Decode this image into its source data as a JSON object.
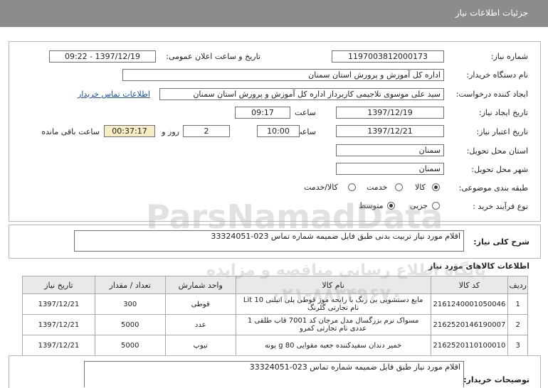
{
  "header": {
    "title": "جزئیات اطلاعات نیاز"
  },
  "form": {
    "need_number_label": "شماره نیاز:",
    "need_number": "1197003812000173",
    "announce_label": "تاریخ و ساعت اعلان عمومی:",
    "announce_value": "1397/12/19 - 09:22",
    "buyer_org_label": "نام دستگاه خریدار:",
    "buyer_org": "اداره کل آموزش و پرورش استان سمنان",
    "requester_label": "ایجاد کننده درخواست:",
    "requester": "سید علی موسوی تلاجیمی کاربرداز اداره کل آموزش و پرورش استان سمنان",
    "contact_link": "اطلاعات تماس خریدار",
    "create_date_label": "تاریخ ایجاد نیاز:",
    "create_date": "1397/12/19",
    "time_label": "ساعت",
    "create_time": "09:17",
    "valid_date_label": "تاریخ اعتبار نیاز:",
    "valid_date": "1397/12/21",
    "valid_time": "10:00",
    "days": "2",
    "days_label": "روز و",
    "remaining": "00:37:17",
    "remaining_label": "ساعت باقی مانده",
    "province_label": "استان محل تحویل:",
    "province": "سمنان",
    "city_label": "شهر محل تحویل:",
    "city": "سمنان",
    "category_label": "طبقه بندی موضوعی:",
    "category_options": [
      "کالا",
      "خدمت",
      "کالا/خدمت"
    ],
    "purchase_label": "نوع فرآیند خرید :",
    "purchase_options": [
      "جزیی",
      "متوسط"
    ]
  },
  "summary": {
    "label": "شرح کلی نیاز:",
    "text": "اقلام مورد نیاز  تربیت بدنی طبق فایل ضمیمه شماره تماس 023-33324051"
  },
  "items_section": {
    "title": "اطلاعات کالاهای مورد نیاز",
    "headers": [
      "ردیف",
      "کد کالا",
      "نام کالا",
      "واحد شمارش",
      "تعداد / مقدار",
      "تاریخ نیاز"
    ],
    "rows": [
      [
        "1",
        "2161240001050046",
        "مایع دستشویی بی رنگ با رایحه موز قوطی پلی اتیلنی 10 Lit نام تجارتی گلرنگ",
        "قوطی",
        "300",
        "1397/12/21"
      ],
      [
        "2",
        "2162520146190007",
        "مسواک نرم بزرگسال مدل مرجان کد 7001 قاب طلقی 1 عددی نام تجارتی کمرو",
        "عدد",
        "5000",
        "1397/12/21"
      ],
      [
        "3",
        "2162520110100010",
        "خمیر دندان سفیدکننده جعبه مقوایی 80 g یونه",
        "تیوپ",
        "5000",
        "1397/12/21"
      ]
    ]
  },
  "notes": {
    "label": "توضیحات خریدار:",
    "text": "اقلام مورد نیاز طبق فایل ضمیمه شماره تماس 023-33324051"
  },
  "watermark": {
    "line1": "ParsNamadData",
    "line2": "پایگاه اطلاع رسانی مناقصه و مزایده",
    "line3": "۰۲۱-۸۸۳۴۹۶۷۰"
  }
}
